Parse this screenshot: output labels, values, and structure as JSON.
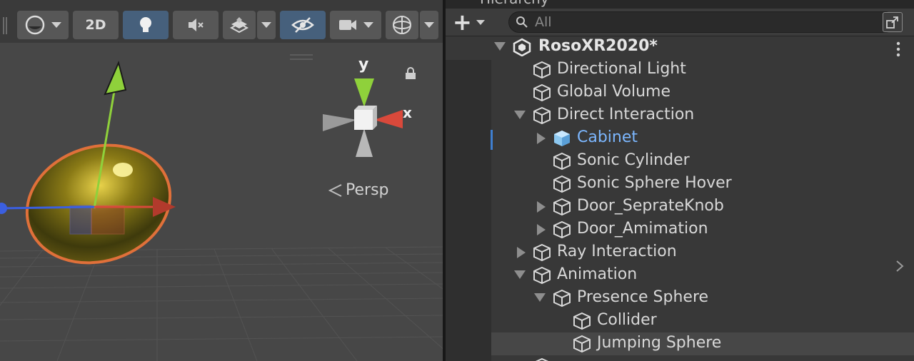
{
  "scene": {
    "toolbar": {
      "btn_2d": "2D"
    },
    "gizmo": {
      "y_label": "y",
      "x_label": "x"
    },
    "persp_label": "Persp",
    "colors": {
      "toolbar_active": "#46607c",
      "gizmo_x": "#d9493b",
      "gizmo_y": "#8fd13b"
    }
  },
  "hierarchy": {
    "tab_title": "Hierarchy",
    "search_placeholder": "All",
    "rows": [
      {
        "label": "RosoXR2020*"
      },
      {
        "label": "Directional Light"
      },
      {
        "label": "Global Volume"
      },
      {
        "label": "Direct Interaction"
      },
      {
        "label": "Cabinet"
      },
      {
        "label": "Sonic Cylinder"
      },
      {
        "label": "Sonic Sphere Hover"
      },
      {
        "label": "Door_SeprateKnob"
      },
      {
        "label": "Door_Amimation"
      },
      {
        "label": "Ray Interaction"
      },
      {
        "label": "Animation"
      },
      {
        "label": "Presence Sphere"
      },
      {
        "label": "Collider"
      },
      {
        "label": "Jumping Sphere"
      },
      {
        "label": ""
      }
    ]
  }
}
